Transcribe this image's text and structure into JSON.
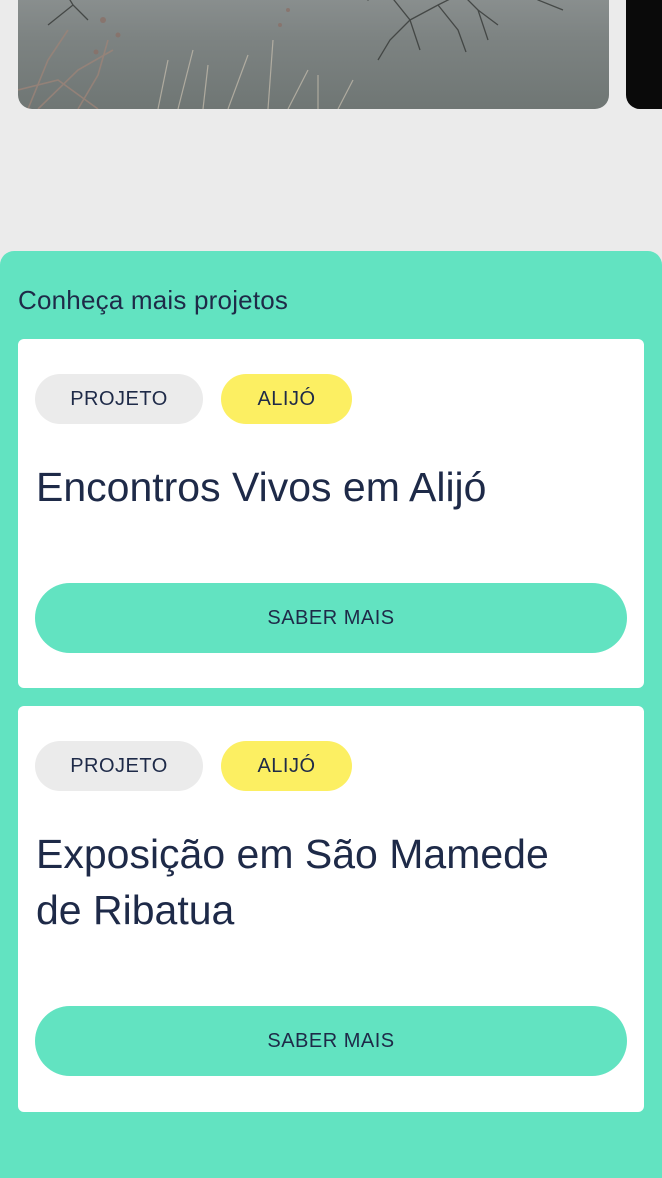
{
  "section": {
    "title": "Conheça mais projetos"
  },
  "projects": [
    {
      "type_tag": "PROJETO",
      "place_tag": "ALIJÓ",
      "title": "Encontros Vivos em Alijó",
      "button_label": "SABER MAIS"
    },
    {
      "type_tag": "PROJETO",
      "place_tag": "ALIJÓ",
      "title": "Exposição em São Mamede de Ribatua",
      "button_label": "SABER MAIS"
    }
  ],
  "colors": {
    "accent": "#62e3c1",
    "tag_place": "#fcef62",
    "tag_type": "#ebebeb",
    "text": "#1e2a48",
    "background": "#ebebeb"
  }
}
